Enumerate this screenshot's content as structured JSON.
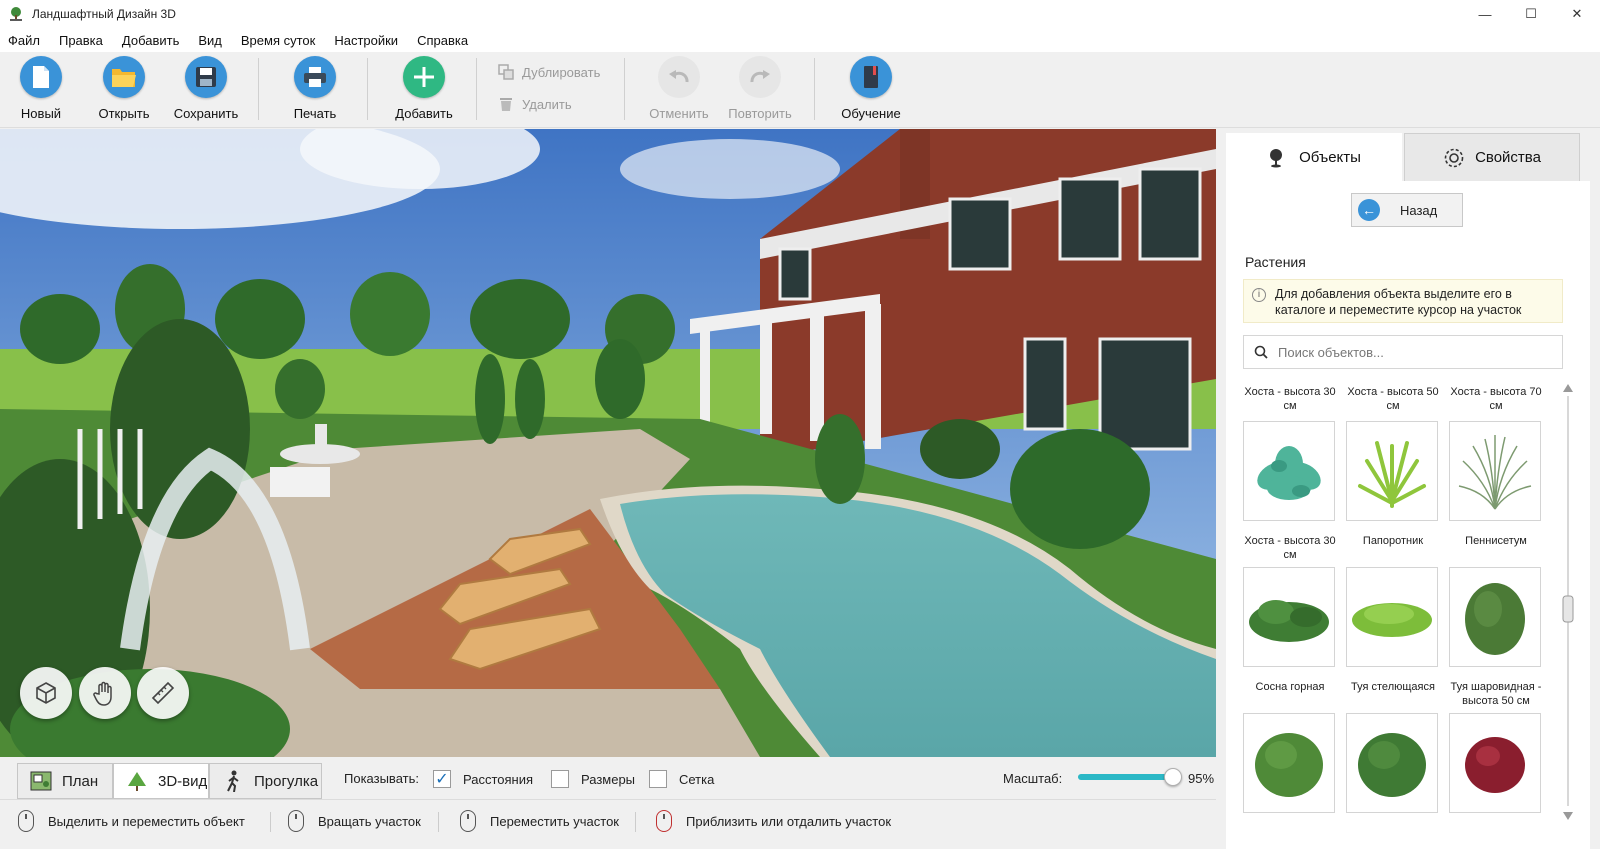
{
  "window": {
    "title": "Ландшафтный Дизайн 3D",
    "controls": [
      "—",
      "☐",
      "✕"
    ]
  },
  "menu": [
    "Файл",
    "Правка",
    "Добавить",
    "Вид",
    "Время суток",
    "Настройки",
    "Справка"
  ],
  "toolbar": {
    "new": "Новый",
    "open": "Открыть",
    "save": "Сохранить",
    "print": "Печать",
    "add": "Добавить",
    "duplicate": "Дублировать",
    "delete": "Удалить",
    "undo": "Отменить",
    "redo": "Повторить",
    "tutorial": "Обучение"
  },
  "panel": {
    "tab_objects": "Объекты",
    "tab_properties": "Свойства",
    "back": "Назад",
    "category": "Растения",
    "hint": "Для добавления объекта выделите его в каталоге и переместите курсор на участок",
    "search_placeholder": "Поиск объектов...",
    "top_captions": [
      "Хоста - высота 30 см",
      "Хоста - высота 50 см",
      "Хоста - высота 70 см"
    ],
    "items": [
      {
        "name": "Хоста - высота 30 см",
        "icon": "hosta-plant-icon",
        "color": "#4fb49a"
      },
      {
        "name": "Папоротник",
        "icon": "fern-plant-icon",
        "color": "#8fc63c"
      },
      {
        "name": "Пеннисетум",
        "icon": "grass-plant-icon",
        "color": "#7d9a70"
      },
      {
        "name": "Сосна горная",
        "icon": "mountain-pine-icon",
        "color": "#3f7d34"
      },
      {
        "name": "Туя стелющаяся",
        "icon": "creeping-thuja-icon",
        "color": "#7dbd3a"
      },
      {
        "name": "Туя шаровидная - высота 50 см",
        "icon": "globe-thuja-icon",
        "color": "#4b7a36"
      },
      {
        "name": "",
        "icon": "shrub-icon",
        "color": "#4f8a38"
      },
      {
        "name": "",
        "icon": "shrub-icon",
        "color": "#3f7a34"
      },
      {
        "name": "",
        "icon": "red-shrub-icon",
        "color": "#8a1e2e"
      }
    ]
  },
  "viewbar": {
    "plan": "План",
    "view3d": "3D-вид",
    "walk": "Прогулка",
    "show_label": "Показывать:",
    "distances": "Расстояния",
    "distances_checked": true,
    "sizes": "Размеры",
    "sizes_checked": false,
    "grid": "Сетка",
    "grid_checked": false,
    "scale_label": "Масштаб:",
    "scale_value": "95%",
    "scale_fraction": 0.95
  },
  "status": {
    "select_move": "Выделить и переместить объект",
    "rotate": "Вращать участок",
    "move": "Переместить участок",
    "zoom": "Приблизить или отдалить участок"
  },
  "colors": {
    "accent": "#3a93d8",
    "add_green": "#2fb883",
    "slider": "#2bb8c6"
  }
}
